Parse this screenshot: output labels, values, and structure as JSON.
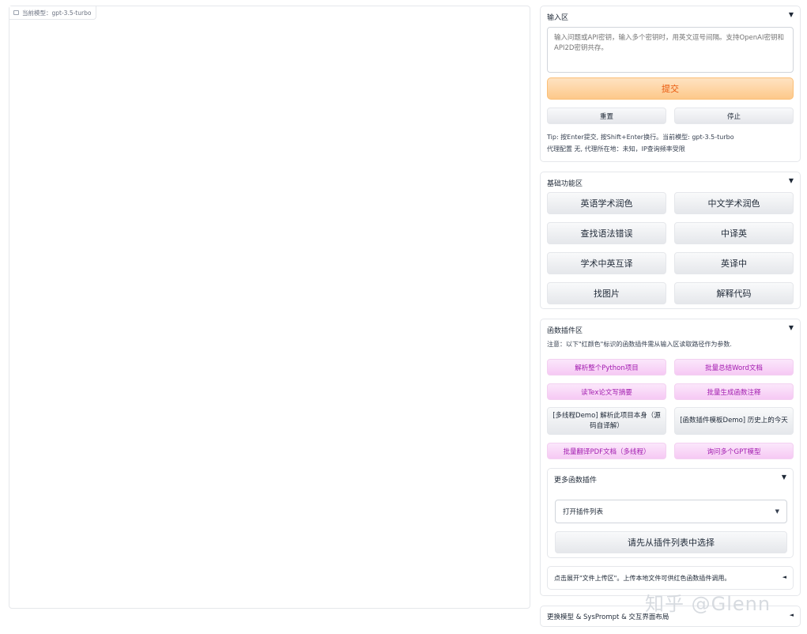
{
  "chat": {
    "model_badge": "当前模型：gpt-3.5-turbo"
  },
  "input_section": {
    "title": "输入区",
    "caret": "▼",
    "placeholder": "输入问题或API密钥，输入多个密钥时，用英文逗号间隔。支持OpenAI密钥和API2D密钥共存。",
    "submit_label": "提交",
    "reset_label": "重置",
    "stop_label": "停止",
    "tip_line1": "Tip: 按Enter提交, 按Shift+Enter换行。当前模型: gpt-3.5-turbo",
    "tip_line2": "代理配置 无, 代理所在地：未知，IP查询频率受限"
  },
  "basic_section": {
    "title": "基础功能区",
    "caret": "▼",
    "buttons": [
      "英语学术润色",
      "中文学术润色",
      "查找语法错误",
      "中译英",
      "学术中英互译",
      "英译中",
      "找图片",
      "解释代码"
    ]
  },
  "plugin_section": {
    "title": "函数插件区",
    "caret": "▼",
    "note": "注意：以下\"红颜色\"标识的函数插件需从输入区读取路径作为参数.",
    "buttons": {
      "parse_python": "解析整个Python项目",
      "batch_word": "批量总结Word文档",
      "read_tex": "读Tex论文写摘要",
      "batch_comment": "批量生成函数注释",
      "multithread_demo": "[多线程Demo] 解析此项目本身（源码自译解）",
      "template_demo": "[函数插件模板Demo] 历史上的今天",
      "batch_pdf": "批量翻译PDF文档（多线程）",
      "ask_gpt": "询问多个GPT模型"
    },
    "more_plugins": {
      "title": "更多函数插件",
      "caret": "▼",
      "select_value": "打开插件列表",
      "select_chev": "▼",
      "action_label": "请先从插件列表中选择"
    },
    "upload_hint": "点击展开\"文件上传区\"。上传本地文件可供红色函数插件调用。",
    "upload_caret": "◄"
  },
  "model_section": {
    "title": "更换模型 & SysPrompt & 交互界面布局",
    "caret": "◄"
  },
  "watermark": "知乎 @Glenn"
}
